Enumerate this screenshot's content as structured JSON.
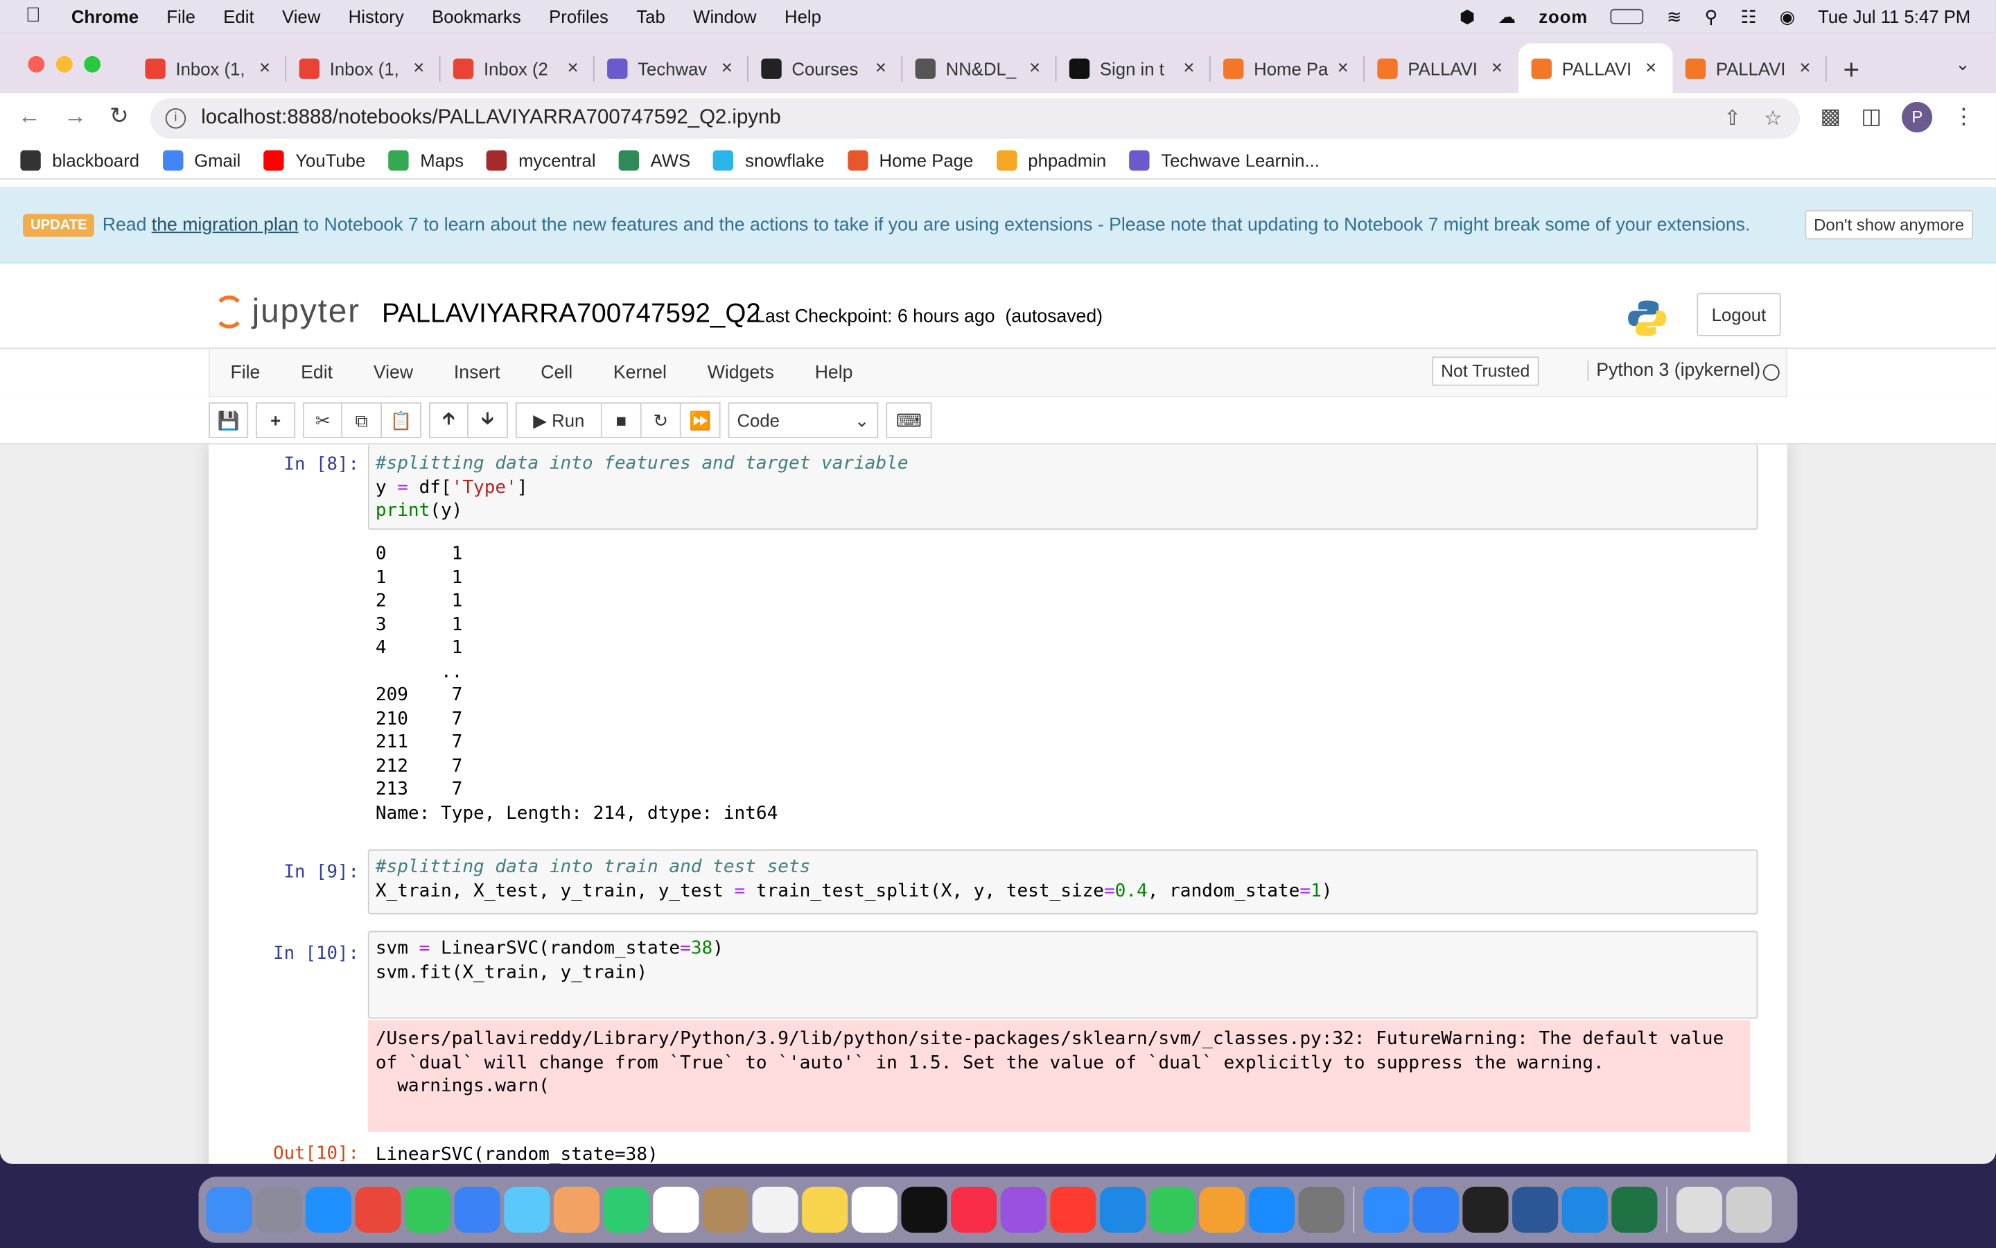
{
  "menubar": {
    "app": "Chrome",
    "items": [
      "File",
      "Edit",
      "View",
      "History",
      "Bookmarks",
      "Profiles",
      "Tab",
      "Window",
      "Help"
    ],
    "zoom": "zoom",
    "datetime": "Tue Jul 11  5:47 PM"
  },
  "tabs": [
    {
      "label": "Inbox (1,",
      "color": "#ea4335"
    },
    {
      "label": "Inbox (1,",
      "color": "#ea4335"
    },
    {
      "label": "Inbox (2",
      "color": "#ea4335"
    },
    {
      "label": "Techwav",
      "color": "#6a5acd"
    },
    {
      "label": "Courses",
      "color": "#222222"
    },
    {
      "label": "NN&DL_",
      "color": "#555555"
    },
    {
      "label": "Sign in t",
      "color": "#111111"
    },
    {
      "label": "Home Pa",
      "color": "#f37726"
    },
    {
      "label": "PALLAVI",
      "color": "#f37726"
    },
    {
      "label": "PALLAVI",
      "color": "#f37726"
    },
    {
      "label": "PALLAVI",
      "color": "#f37726"
    }
  ],
  "active_tab_index": 9,
  "address": {
    "url": "localhost:8888/notebooks/PALLAVIYARRA700747592_Q2.ipynb",
    "profile_initial": "P"
  },
  "bookmarks": [
    {
      "label": "blackboard",
      "color": "#333333"
    },
    {
      "label": "Gmail",
      "color": "#4285f4"
    },
    {
      "label": "YouTube",
      "color": "#ff0000"
    },
    {
      "label": "Maps",
      "color": "#34a853"
    },
    {
      "label": "mycentral",
      "color": "#a52a2a"
    },
    {
      "label": "AWS",
      "color": "#2e8b57"
    },
    {
      "label": "snowflake",
      "color": "#29b5e8"
    },
    {
      "label": "Home Page",
      "color": "#e8572c"
    },
    {
      "label": "phpadmin",
      "color": "#f5a623"
    },
    {
      "label": "Techwave Learnin...",
      "color": "#6a5acd"
    }
  ],
  "banner": {
    "badge": "UPDATE",
    "text_before": "Read ",
    "link": "the migration plan",
    "text_after": " to Notebook 7 to learn about the new features and the actions to take if you are using extensions - Please note that updating to Notebook 7 might break some of your extensions.",
    "dismiss": "Don't show anymore"
  },
  "header": {
    "logo_text": "jupyter",
    "notebook_name": "PALLAVIYARRA700747592_Q2",
    "checkpoint": "Last Checkpoint: 6 hours ago  (autosaved)",
    "logout": "Logout"
  },
  "nbmenu": {
    "items": [
      "File",
      "Edit",
      "View",
      "Insert",
      "Cell",
      "Kernel",
      "Widgets",
      "Help"
    ],
    "trust": "Not Trusted",
    "kernel": "Python 3 (ipykernel)"
  },
  "toolbar": {
    "run": "Run",
    "cell_type": "Code"
  },
  "cells": {
    "c8": {
      "prompt": "In [8]:",
      "output": "0      1\n1      1\n2      1\n3      1\n4      1\n      ..\n209    7\n210    7\n211    7\n212    7\n213    7\nName: Type, Length: 214, dtype: int64"
    },
    "c9": {
      "prompt": "In [9]:"
    },
    "c10": {
      "prompt": "In [10]:",
      "stderr": "/Users/pallavireddy/Library/Python/3.9/lib/python/site-packages/sklearn/svm/_classes.py:32: FutureWarning: The default value of `dual` will change from `True` to `'auto'` in 1.5. Set the value of `dual` explicitly to suppress the warning.\n  warnings.warn(",
      "out_prompt": "Out[10]:",
      "out": "LinearSVC(random_state=38)"
    }
  },
  "dock_apps": [
    {
      "name": "Finder",
      "color": "#3d8ef7"
    },
    {
      "name": "Launchpad",
      "color": "#8a8a9a"
    },
    {
      "name": "Safari",
      "color": "#1e90ff"
    },
    {
      "name": "Chrome",
      "color": "#e9473a"
    },
    {
      "name": "Messages",
      "color": "#34c759"
    },
    {
      "name": "Mail",
      "color": "#3b82f6"
    },
    {
      "name": "Maps",
      "color": "#5ac8fa"
    },
    {
      "name": "Photos",
      "color": "#f4a261"
    },
    {
      "name": "FaceTime",
      "color": "#2ecc71"
    },
    {
      "name": "Calendar",
      "color": "#ffffff"
    },
    {
      "name": "Contacts",
      "color": "#b08a5b"
    },
    {
      "name": "Reminders",
      "color": "#f2f2f2"
    },
    {
      "name": "Notes",
      "color": "#f7d44c"
    },
    {
      "name": "Freeform",
      "color": "#ffffff"
    },
    {
      "name": "TV",
      "color": "#111111"
    },
    {
      "name": "Music",
      "color": "#fa2d48"
    },
    {
      "name": "Podcasts",
      "color": "#9b51e0"
    },
    {
      "name": "News",
      "color": "#ff3b30"
    },
    {
      "name": "Keynote",
      "color": "#1e88e5"
    },
    {
      "name": "Numbers",
      "color": "#34c759"
    },
    {
      "name": "Pages",
      "color": "#f4a030"
    },
    {
      "name": "App Store",
      "color": "#1a8cff"
    },
    {
      "name": "System Settings",
      "color": "#777777"
    },
    {
      "name": "Zoom",
      "color": "#2d8cff"
    },
    {
      "name": "Bluetooth",
      "color": "#2f7ff5"
    },
    {
      "name": "Terminal",
      "color": "#222222"
    },
    {
      "name": "Word",
      "color": "#2b5797"
    },
    {
      "name": "VS Code",
      "color": "#1e88e5"
    },
    {
      "name": "Excel",
      "color": "#1f7244"
    },
    {
      "name": "Documents",
      "color": "#dddddd"
    },
    {
      "name": "Trash",
      "color": "#cfcfcf"
    }
  ]
}
